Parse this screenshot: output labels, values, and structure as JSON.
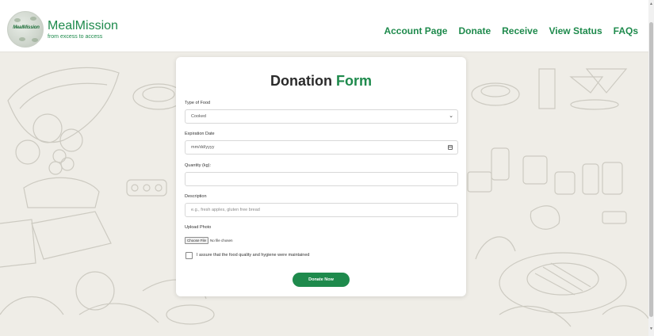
{
  "header": {
    "brand_name": "MealMission",
    "brand_tagline": "from excess to access",
    "logo_text": "MealMission",
    "nav": [
      "Account Page",
      "Donate",
      "Receive",
      "View Status",
      "FAQs"
    ]
  },
  "form": {
    "title_main": "Donation",
    "title_accent": "Form",
    "type_label": "Type of Food",
    "type_value": "Cooked",
    "expiration_label": "Expiration Date",
    "expiration_placeholder": "mm/dd/yyyy",
    "quantity_label": "Quantity (kg):",
    "quantity_value": "",
    "description_label": "Description",
    "description_placeholder": "e.g., fresh apples, gluten free bread",
    "photo_label": "Upload Photo",
    "file_button": "Choose File",
    "file_status": "No file chosen",
    "assurance_label": "I assure that the food quality and hygiene were maintained",
    "submit_label": "Donate Now"
  },
  "colors": {
    "brand_green": "#1e8a4c",
    "background": "#efede7",
    "card": "#ffffff"
  }
}
